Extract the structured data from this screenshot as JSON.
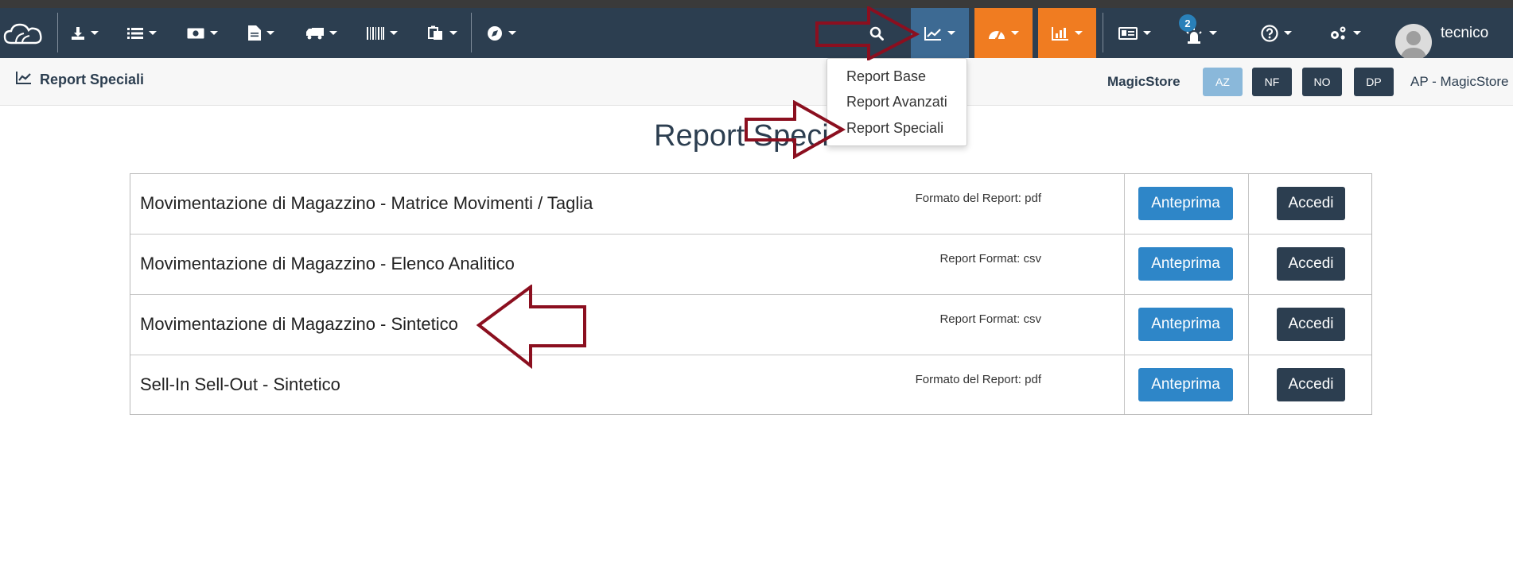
{
  "navbar": {
    "items": [
      {
        "icon": "cloud-logo-icon"
      },
      {
        "icon": "download-icon"
      },
      {
        "icon": "list-icon"
      },
      {
        "icon": "money-icon"
      },
      {
        "icon": "document-icon"
      },
      {
        "icon": "truck-icon"
      },
      {
        "icon": "barcode-icon"
      },
      {
        "icon": "clipboard-icon"
      },
      {
        "icon": "compass-icon"
      },
      {
        "icon": "search-icon"
      },
      {
        "icon": "line-chart-icon"
      },
      {
        "icon": "dashboard-icon"
      },
      {
        "icon": "bar-chart-icon"
      },
      {
        "icon": "id-card-icon"
      },
      {
        "icon": "alarm-icon"
      },
      {
        "icon": "help-icon"
      },
      {
        "icon": "cogs-icon"
      }
    ],
    "notification_count": "2",
    "username": "tecnico",
    "colors": {
      "bar": "#2c3e50",
      "active": "#3d6a93",
      "orange": "#f07c21"
    }
  },
  "subbar": {
    "title": "Report Speciali",
    "store": "MagicStore",
    "buttons": [
      "AZ",
      "NF",
      "NO",
      "DP"
    ],
    "store_right": "AP - MagicStore"
  },
  "dropdown": {
    "items": [
      "Report Base",
      "Report Avanzati",
      "Report Speciali"
    ]
  },
  "main": {
    "title": "Report Speciali",
    "rows": [
      {
        "name": "Movimentazione di Magazzino - Matrice Movimenti / Taglia",
        "format": "Formato del Report: pdf",
        "preview": "Anteprima",
        "access": "Accedi"
      },
      {
        "name": "Movimentazione di Magazzino - Elenco Analitico",
        "format": "Report Format: csv",
        "preview": "Anteprima",
        "access": "Accedi"
      },
      {
        "name": "Movimentazione di Magazzino - Sintetico",
        "format": "Report Format: csv",
        "preview": "Anteprima",
        "access": "Accedi"
      },
      {
        "name": "Sell-In Sell-Out - Sintetico",
        "format": "Formato del Report: pdf",
        "preview": "Anteprima",
        "access": "Accedi"
      }
    ]
  },
  "annotations": {
    "arrow_color": "#8b0f1f"
  }
}
